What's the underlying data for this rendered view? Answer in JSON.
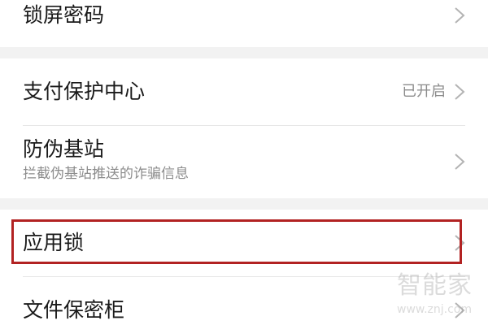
{
  "rows": {
    "lock_screen_password": {
      "title": "锁屏密码"
    },
    "payment_protection": {
      "title": "支付保护中心",
      "status": "已开启"
    },
    "fake_base_station": {
      "title": "防伪基站",
      "subtitle": "拦截伪基站推送的诈骗信息"
    },
    "app_lock": {
      "title": "应用锁"
    },
    "file_safe": {
      "title": "文件保密柜"
    }
  },
  "colors": {
    "highlight_border": "#b22222",
    "background": "#f2f2f2",
    "card": "#ffffff"
  },
  "watermark": {
    "text": "智能家",
    "url": "www.znj.com"
  }
}
